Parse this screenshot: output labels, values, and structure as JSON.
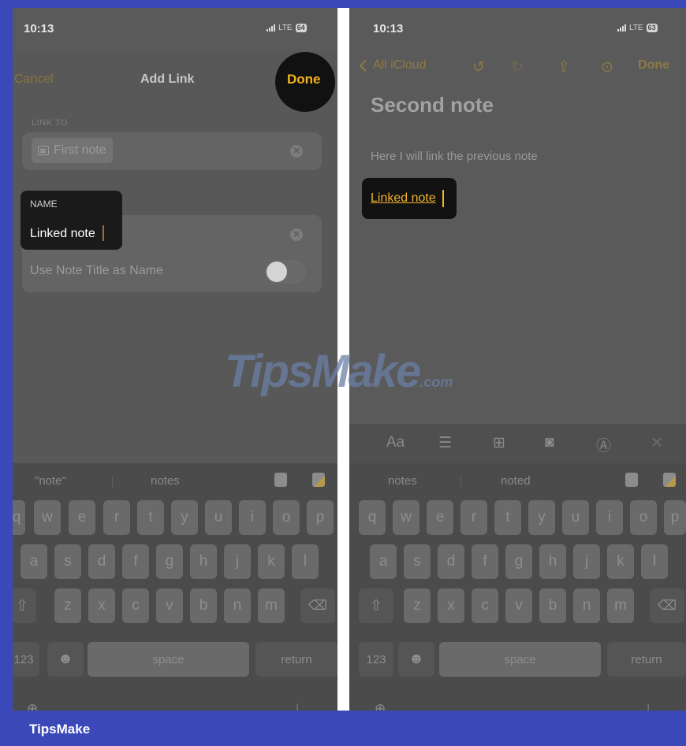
{
  "left": {
    "status": {
      "time": "10:13",
      "network": "LTE",
      "battery": "64"
    },
    "nav": {
      "cancel": "Cancel",
      "title": "Add Link",
      "done": "Done"
    },
    "link_to": {
      "label": "LINK TO",
      "value": "First note"
    },
    "name": {
      "label": "NAME",
      "value": "Linked note"
    },
    "toggle": {
      "label": "Use Note Title as Name",
      "on": false
    },
    "suggestions": [
      "\"note\"",
      "notes"
    ]
  },
  "right": {
    "status": {
      "time": "10:13",
      "network": "LTE",
      "battery": "63"
    },
    "nav": {
      "back": "All iCloud",
      "done": "Done"
    },
    "note": {
      "title": "Second note",
      "body": "Here I will link the previous note",
      "link": "Linked note"
    },
    "format_bar": {
      "text_style": "Aa"
    },
    "suggestions": [
      "notes",
      "noted"
    ]
  },
  "keyboard": {
    "row1": [
      "q",
      "w",
      "e",
      "r",
      "t",
      "y",
      "u",
      "i",
      "o",
      "p"
    ],
    "row2": [
      "a",
      "s",
      "d",
      "f",
      "g",
      "h",
      "j",
      "k",
      "l"
    ],
    "row3": [
      "z",
      "x",
      "c",
      "v",
      "b",
      "n",
      "m"
    ],
    "numbers": "123",
    "space": "space",
    "return": "return"
  },
  "watermark": {
    "main": "TipsMake",
    "suffix": ".com"
  },
  "footer": {
    "brand": "TipsMake"
  },
  "colors": {
    "accent": "#f3b31c",
    "frame": "#3a48b8"
  }
}
